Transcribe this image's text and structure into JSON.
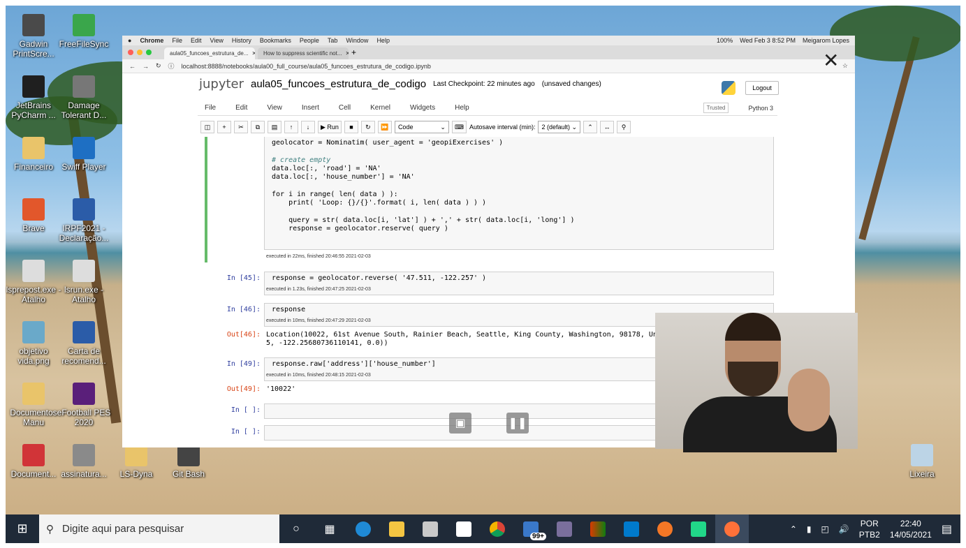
{
  "desktop_icons": [
    {
      "label": "Gadwin PrintScre...",
      "icon": "printscreen-icon",
      "color": "#4a4a4a"
    },
    {
      "label": "FreeFileSync",
      "icon": "sync-icon",
      "color": "#3aa64b"
    },
    {
      "label": "JetBrains PyCharm ...",
      "icon": "pycharm-icon",
      "color": "#1f1f1f"
    },
    {
      "label": "Damage Tolerant D...",
      "icon": "app-icon",
      "color": "#777777"
    },
    {
      "label": "Financeiro",
      "icon": "folder-icon",
      "color": "#e9c46a"
    },
    {
      "label": "Swiff Player",
      "icon": "swiff-icon",
      "color": "#1e6fc3"
    },
    {
      "label": "Brave",
      "icon": "brave-icon",
      "color": "#e2572b"
    },
    {
      "label": "IRPF2021 - Declaração...",
      "icon": "irpf-icon",
      "color": "#2b5ca8"
    },
    {
      "label": "lsprepost.exe - Atalho",
      "icon": "lsprepost-icon",
      "color": "#dddddd"
    },
    {
      "label": "lsrun.exe - Atalho",
      "icon": "lsrun-icon",
      "color": "#dddddd"
    },
    {
      "label": "objetivo vida.png",
      "icon": "image-icon",
      "color": "#6aa9c9"
    },
    {
      "label": "Carta de recomend...",
      "icon": "word-doc-icon",
      "color": "#2b5ca8"
    },
    {
      "label": "Documentos Manu",
      "icon": "folder-icon",
      "color": "#e9c46a"
    },
    {
      "label": "eFootball PES 2020",
      "icon": "pes-icon",
      "color": "#5a1f7a"
    },
    {
      "label": "Document...",
      "icon": "pdf-icon",
      "color": "#d13438"
    },
    {
      "label": "assinatura...",
      "icon": "image-icon",
      "color": "#8a8a8a"
    },
    {
      "label": "LS-Dyna",
      "icon": "folder-icon",
      "color": "#e9c46a"
    },
    {
      "label": "Git Bash",
      "icon": "git-icon",
      "color": "#444444"
    },
    {
      "label": "Lixeira",
      "icon": "recycle-bin-icon",
      "color": "#bcd4e6"
    }
  ],
  "mac_menubar": {
    "app": "Chrome",
    "items": [
      "File",
      "Edit",
      "View",
      "History",
      "Bookmarks",
      "People",
      "Tab",
      "Window",
      "Help"
    ],
    "battery": "100%",
    "clock": "Wed Feb 3  8:52 PM",
    "user": "Meigarom Lopes"
  },
  "browser": {
    "tabs": [
      {
        "title": "aula05_funcoes_estrutura_de..."
      },
      {
        "title": "How to suppress scientific not..."
      }
    ],
    "url": "localhost:8888/notebooks/aula00_full_course/aula05_funcoes_estrutura_de_codigo.ipynb"
  },
  "jupyter": {
    "logo": "jupyter",
    "notebook_name": "aula05_funcoes_estrutura_de_codigo",
    "checkpoint": "Last Checkpoint: 22 minutes ago",
    "unsaved": "(unsaved changes)",
    "logout": "Logout",
    "menu": [
      "File",
      "Edit",
      "View",
      "Insert",
      "Cell",
      "Kernel",
      "Widgets",
      "Help"
    ],
    "trusted": "Trusted",
    "kernel": "Python 3",
    "toolbar": {
      "run": "Run",
      "cell_type": "Code",
      "autosave_label": "Autosave interval (min):",
      "autosave_value": "2 (default)"
    },
    "cells": {
      "c1_lines": [
        "geolocator = Nominatim( user_agent = 'geopiExercises' )",
        "",
        "# create empty",
        "data.loc[:, 'road'] = 'NA'",
        "data.loc[:, 'house_number'] = 'NA'",
        "",
        "for i in range( len( data ) ):",
        "    print( 'Loop: {}/{}'.format( i, len( data ) ) )",
        "",
        "    query = str( data.loc[i, 'lat'] ) + ',' + str( data.loc[i, 'long'] )",
        "    response = geolocator.reserve( query )"
      ],
      "c1_exec": "executed in 22ms, finished 20:46:55 2021-02-03",
      "c2_prompt": "In [45]:",
      "c2_code": "response = geolocator.reverse( '47.511, -122.257' )",
      "c2_exec": "executed in 1.23s, finished 20:47:25 2021-02-03",
      "c3_prompt": "In [46]:",
      "c3_code": "response",
      "c3_exec": "executed in 10ms, finished 20:47:29 2021-02-03",
      "c3_out_prompt": "Out[46]:",
      "c3_out": "Location(10022, 61st Avenue South, Rainier Beach, Seattle, King County, Washington, 98178, United States, (47\n5, -122.25680736110141, 0.0))",
      "c4_prompt": "In [49]:",
      "c4_code": "response.raw['address']['house_number']",
      "c4_exec": "executed in 10ms, finished 20:48:15 2021-02-03",
      "c4_out_prompt": "Out[49]:",
      "c4_out": "'10022'",
      "c5_prompt": "In [ ]:",
      "c6_prompt": "In [ ]:"
    }
  },
  "taskbar": {
    "search_placeholder": "Digite aqui para pesquisar",
    "mail_badge": "99+",
    "lang_top": "POR",
    "lang_bottom": "PTB2",
    "time": "22:40",
    "date": "14/05/2021"
  }
}
